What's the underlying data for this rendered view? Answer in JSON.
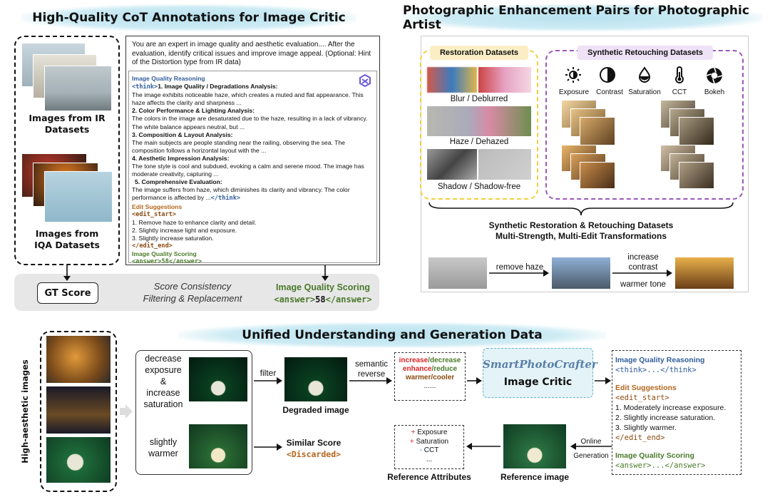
{
  "top_left": {
    "title": "High-Quality CoT Annotations for Image Critic",
    "ir_label": "Images from IR\nDatasets",
    "iqa_label": "Images from\nIQA Datasets",
    "prompt_text": "You are an expert in image quality and aesthetic evaluation....  After the evaluation, identify critical issues and improve image appeal. (Optional: Hint of the Distortion type from IR data)",
    "reasoning": {
      "header": "Image Quality Reasoning",
      "think_open": "<think>",
      "s1_title": "1. Image Quality / Degradations Analysis:",
      "s1_body": "The image exhibits noticeable haze, which creates a muted and flat appearance. This haze affects the clarity and sharpness ...",
      "s2_title": "2. Color Performance & Lighting Analysis:",
      "s2_body": "The colors in the image are desaturated due to the haze, resulting in a lack of vibrancy. The white balance appears neutral, but ...",
      "s3_title": "3. Composition & Layout Analysis:",
      "s3_body": "The main subjects are people standing near the railing, observing the sea. The composition follows a horizontal layout with the ...",
      "s4_title": "4. Aesthetic Impression Analysis:",
      "s4_body": "The tone style is cool and subdued, evoking a calm and serene mood. The image has moderate creativity, capturing ...",
      "s5_title": "5. Comprehensive Evaluation:",
      "s5_body": "The image suffers from haze, which diminishes its clarity and vibrancy. The color performance is affected by ...",
      "think_close": "</think>",
      "edit_header": "Edit Suggestions",
      "edit_start": "<edit_start>",
      "edit_1": "1. Remove haze to enhance clarity and detail.",
      "edit_2": "2. Slightly increase light and exposure.",
      "edit_3": "3. Slightly increase saturation.",
      "edit_end": "</edit_end>",
      "score_header": "Image Quality Scoring",
      "answer": "<answer>58</answer>"
    },
    "gt_score": "GT Score",
    "consistency": "Score Consistency\nFiltering & Replacement",
    "scoring_label": "Image Quality Scoring",
    "scoring_answer_open": "<answer>",
    "scoring_answer_value": "58",
    "scoring_answer_close": "</answer>"
  },
  "top_right": {
    "title": "Photographic Enhancement Pairs for Photographic Artist",
    "restoration_title": "Restoration Datasets",
    "retouch_title": "Synthetic Retouching Datasets",
    "pair_1": "Blur / Deblurred",
    "pair_2": "Haze / Dehazed",
    "pair_3": "Shadow / Shadow-free",
    "attrs": [
      "Exposure",
      "Contrast",
      "Saturation",
      "CCT",
      "Bokeh"
    ],
    "synthetic_caption": "Synthetic Restoration & Retouching Datasets\nMulti-Strength, Multi-Edit Transformations",
    "step_1": "remove haze",
    "step_2": "increase\ncontrast",
    "step_3": "warmer tone"
  },
  "bottom": {
    "title": "Unified Understanding and Generation Data",
    "side_label": "High-aesthetic images",
    "op_1": "decrease\nexposure\n&\nincrease\nsaturation",
    "op_2": "slightly\nwarmer",
    "filter": "filter",
    "semantic": "semantic\nreverse",
    "degraded": "Degraded image",
    "similar": "Similar Score",
    "discarded": "<Discarded>",
    "rev_1a": "increase",
    "rev_1b": "/decrease",
    "rev_2a": "enhance",
    "rev_2b": "/reduce",
    "rev_3": "warmer/cooler",
    "rev_dots": "......",
    "logo": "SmartPhotoCrafter",
    "critic": "Image Critic",
    "out_header": "Image Quality Reasoning",
    "out_think": "<think>...</think>",
    "out_edit_header": "Edit Suggestions",
    "out_edit_start": "<edit_start>",
    "out_1": "1. Moderately increase exposure.",
    "out_2": "2. Slightly increase saturation.",
    "out_3": "3. Slightly warmer.",
    "out_edit_end": "</edit_end>",
    "out_score_header": "Image Quality Scoring",
    "out_answer": "<answer>...</answer>",
    "online": "Online\nGeneration",
    "reference_image": "Reference image",
    "reference_attrs": "Reference Attributes",
    "ref_1": "Exposure",
    "ref_2": "Saturation",
    "ref_3": "CCT",
    "ref_dots": "..."
  }
}
